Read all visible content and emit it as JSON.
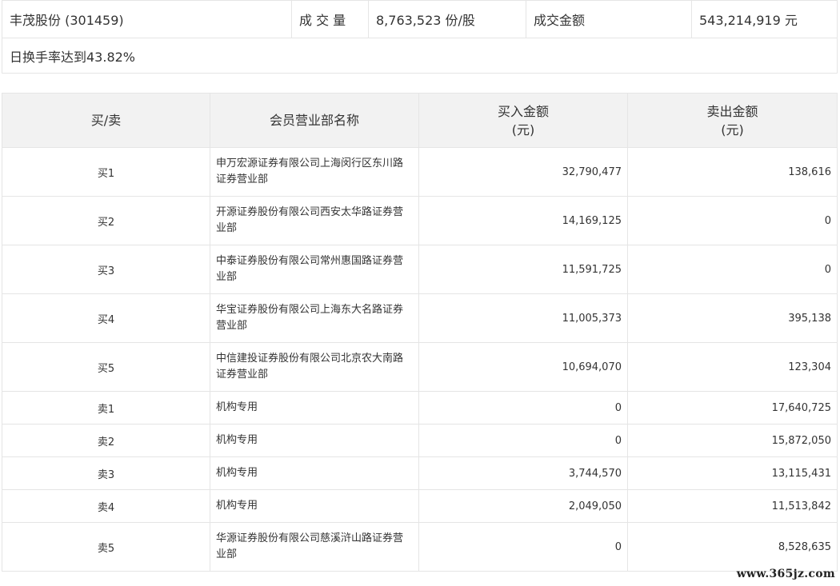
{
  "summary": {
    "stock": "丰茂股份 (301459)",
    "volume_label": "成 交 量",
    "volume_value": "8,763,523 份/股",
    "amount_label": "成交金额",
    "amount_value": "543,214,919 元",
    "turnover": "日换手率达到43.82%"
  },
  "table": {
    "headers": {
      "side": "买/卖",
      "name": "会员营业部名称",
      "buy_line1": "买入金额",
      "buy_line2": "(元)",
      "sell_line1": "卖出金额",
      "sell_line2": "(元)"
    },
    "rows": [
      {
        "side": "买1",
        "name": "申万宏源证券有限公司上海闵行区东川路证券营业部",
        "buy": "32,790,477",
        "sell": "138,616"
      },
      {
        "side": "买2",
        "name": "开源证券股份有限公司西安太华路证券营业部",
        "buy": "14,169,125",
        "sell": "0"
      },
      {
        "side": "买3",
        "name": "中泰证券股份有限公司常州惠国路证券营业部",
        "buy": "11,591,725",
        "sell": "0"
      },
      {
        "side": "买4",
        "name": "华宝证券股份有限公司上海东大名路证券营业部",
        "buy": "11,005,373",
        "sell": "395,138"
      },
      {
        "side": "买5",
        "name": "中信建投证券股份有限公司北京农大南路证券营业部",
        "buy": "10,694,070",
        "sell": "123,304"
      },
      {
        "side": "卖1",
        "name": "机构专用",
        "buy": "0",
        "sell": "17,640,725"
      },
      {
        "side": "卖2",
        "name": "机构专用",
        "buy": "0",
        "sell": "15,872,050"
      },
      {
        "side": "卖3",
        "name": "机构专用",
        "buy": "3,744,570",
        "sell": "13,115,431"
      },
      {
        "side": "卖4",
        "name": "机构专用",
        "buy": "2,049,050",
        "sell": "11,513,842"
      },
      {
        "side": "卖5",
        "name": "华源证券股份有限公司慈溪浒山路证券营业部",
        "buy": "0",
        "sell": "8,528,635"
      }
    ]
  },
  "watermark": "www.365jz.com"
}
